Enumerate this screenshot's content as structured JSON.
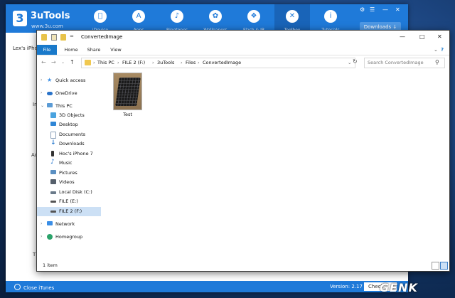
{
  "tutools": {
    "brand": "3uTools",
    "url": "www.3u.com",
    "logo_glyph": "3",
    "nav": [
      {
        "label": "iDevice",
        "icon": "apple-icon"
      },
      {
        "label": "Apps",
        "icon": "appstore-icon"
      },
      {
        "label": "Ringtones",
        "icon": "bell-icon"
      },
      {
        "label": "Wallpapers",
        "icon": "flower-icon"
      },
      {
        "label": "Flash & JB",
        "icon": "dropbox-icon"
      },
      {
        "label": "Toolbox",
        "icon": "tools-icon"
      },
      {
        "label": "Tutorials",
        "icon": "info-icon"
      }
    ],
    "downloads": "Downloads",
    "device_label": "Lex's iPhon",
    "side_letters": [
      "In",
      "Ac",
      "T"
    ],
    "close_itunes": "Close iTunes",
    "version": "Version: 2.17",
    "check": "Check",
    "accent": "#1f7ad9"
  },
  "explorer": {
    "title": "ConvertedImage",
    "tabs": [
      "File",
      "Home",
      "Share",
      "View"
    ],
    "address": [
      "This PC",
      "FILE 2 (F:)",
      "3uTools",
      "Files",
      "ConvertedImage"
    ],
    "search_placeholder": "Search ConvertedImage",
    "nav": [
      {
        "label": "Quick access",
        "icon": "star-icon",
        "color": "#3a8ee6"
      },
      {
        "label": "OneDrive",
        "icon": "cloud-icon",
        "color": "#2a73c9"
      },
      {
        "label": "This PC",
        "icon": "computer-icon",
        "color": "#5b9bd5"
      },
      {
        "label": "3D Objects",
        "icon": "cube-icon",
        "color": "#4aa3df"
      },
      {
        "label": "Desktop",
        "icon": "desktop-icon",
        "color": "#2f86d6"
      },
      {
        "label": "Documents",
        "icon": "document-icon",
        "color": "#8aa0b8"
      },
      {
        "label": "Downloads",
        "icon": "download-icon",
        "color": "#2b7bd0"
      },
      {
        "label": "Hoc's iPhone 7",
        "icon": "phone-icon",
        "color": "#333333"
      },
      {
        "label": "Music",
        "icon": "music-icon",
        "color": "#2b7bd0"
      },
      {
        "label": "Pictures",
        "icon": "pictures-icon",
        "color": "#5a8fc2"
      },
      {
        "label": "Videos",
        "icon": "video-icon",
        "color": "#555f6b"
      },
      {
        "label": "Local Disk (C:)",
        "icon": "disk-icon",
        "color": "#6a7a8a"
      },
      {
        "label": "FILE (E:)",
        "icon": "drive-icon",
        "color": "#555555"
      },
      {
        "label": "FILE 2 (F:)",
        "icon": "drive-icon",
        "color": "#555555"
      },
      {
        "label": "Network",
        "icon": "network-icon",
        "color": "#3a8ee6"
      },
      {
        "label": "Homegroup",
        "icon": "homegroup-icon",
        "color": "#2ba36a"
      }
    ],
    "file": {
      "name": "Test",
      "type": "image"
    },
    "status": "1 item"
  },
  "watermark": "GENK"
}
